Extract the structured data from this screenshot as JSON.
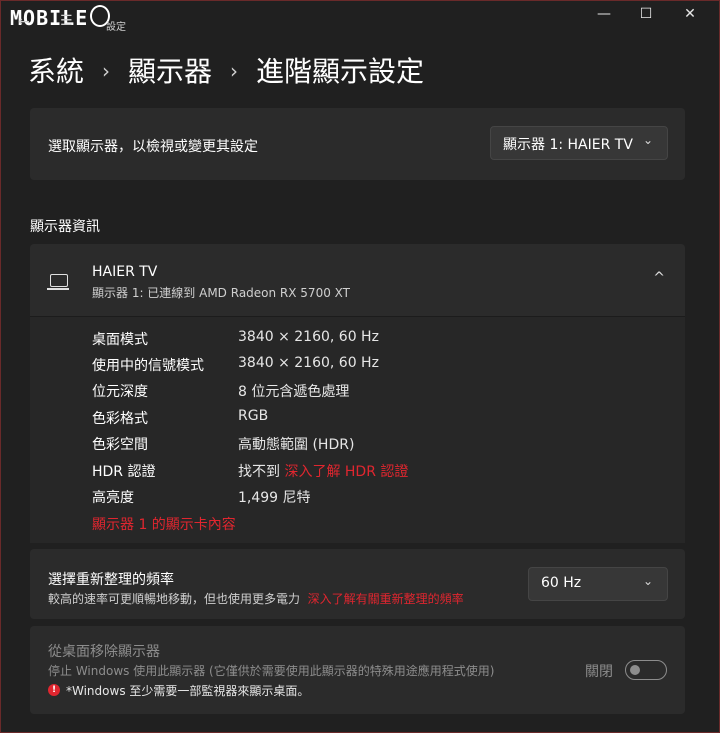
{
  "titlebar": {
    "logo_text": "MOBILE",
    "back_glyph": "←",
    "menu_glyph": "☰",
    "app_title": "設定",
    "minimize_glyph": "—",
    "maximize_glyph": "☐",
    "close_glyph": "✕"
  },
  "breadcrumb": {
    "items": [
      "系統",
      "顯示器",
      "進階顯示設定"
    ],
    "separator": "›"
  },
  "select_display": {
    "label": "選取顯示器，以檢視或變更其設定",
    "value": "顯示器 1: HAIER TV",
    "chevron": "⌄"
  },
  "display_info": {
    "section_title": "顯示器資訊",
    "device_name": "HAIER TV",
    "device_sub": "顯示器 1: 已連線到 AMD Radeon RX 5700 XT",
    "collapse_glyph": "^",
    "rows": [
      {
        "key": "桌面模式",
        "value": "3840 × 2160, 60 Hz"
      },
      {
        "key": "使用中的信號模式",
        "value": "3840 × 2160, 60 Hz"
      },
      {
        "key": "位元深度",
        "value": "8 位元含遞色處理"
      },
      {
        "key": "色彩格式",
        "value": "RGB"
      },
      {
        "key": "色彩空間",
        "value": "高動態範圍 (HDR)"
      },
      {
        "key": "HDR 認證",
        "value": "找不到",
        "link": "深入了解 HDR 認證"
      },
      {
        "key": "高亮度",
        "value": "1,499 尼特"
      }
    ],
    "adapter_link": "顯示器 1 的顯示卡內容"
  },
  "refresh_rate": {
    "title": "選擇重新整理的頻率",
    "description": "較高的速率可更順暢地移動，但也使用更多電力",
    "link": "深入了解有關重新整理的頻率",
    "value": "60 Hz",
    "chevron": "⌄"
  },
  "remove_display": {
    "title": "從桌面移除顯示器",
    "description": "停止 Windows 使用此顯示器 (它僅供於需要使用此顯示器的特殊用途應用程式使用)",
    "toggle_label": "關閉",
    "toggle_on": false,
    "error_glyph": "!",
    "error_text": "*Windows 至少需要一部監視器來顯示桌面。"
  },
  "colors": {
    "background": "#202020",
    "card": "#2b2b2b",
    "link_red": "#e0262f",
    "disabled": "#8d8d8d"
  }
}
